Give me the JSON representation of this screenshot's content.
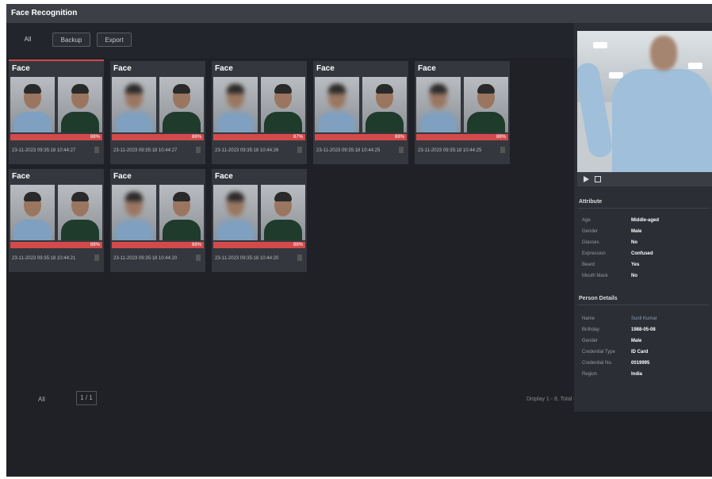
{
  "app": {
    "title": "Face Recognition"
  },
  "toolbar": {
    "all": "All",
    "backup": "Backup",
    "export": "Export"
  },
  "cards": [
    {
      "label": "Face",
      "score": "88%",
      "time": "23-11-2023 09:35:18 10:44:27",
      "selected": true
    },
    {
      "label": "Face",
      "score": "88%",
      "time": "23-11-2023 09:35:18 10:44:27",
      "selected": false
    },
    {
      "label": "Face",
      "score": "87%",
      "time": "23-11-2023 09:35:18 10:44:26",
      "selected": false
    },
    {
      "label": "Face",
      "score": "88%",
      "time": "23-11-2023 09:35:18 10:44:25",
      "selected": false
    },
    {
      "label": "Face",
      "score": "88%",
      "time": "23-11-2023 09:35:18 10:44:25",
      "selected": false
    },
    {
      "label": "Face",
      "score": "88%",
      "time": "23-11-2023 09:35:18 10:44:21",
      "selected": false
    },
    {
      "label": "Face",
      "score": "88%",
      "time": "23-11-2023 09:35:18 10:44:20",
      "selected": false
    },
    {
      "label": "Face",
      "score": "88%",
      "time": "23-11-2023 09:35:18 10:44:20",
      "selected": false
    }
  ],
  "pager": {
    "left": "All",
    "box": "1 / 1",
    "right": "Display 1 - 8, Total 8"
  },
  "attributes": {
    "title": "Attribute",
    "rows": [
      {
        "k": "Age",
        "v": "Middle-aged"
      },
      {
        "k": "Gender",
        "v": "Male"
      },
      {
        "k": "Glasses",
        "v": "No"
      },
      {
        "k": "Expression",
        "v": "Confused"
      },
      {
        "k": "Beard",
        "v": "Yes"
      },
      {
        "k": "Mouth Mask",
        "v": "No"
      }
    ]
  },
  "person": {
    "title": "Person Details",
    "rows": [
      {
        "k": "Name",
        "v": "Sunil Kumar"
      },
      {
        "k": "Birthday",
        "v": "1988-05-08"
      },
      {
        "k": "Gender",
        "v": "Male"
      },
      {
        "k": "Credential Type",
        "v": "ID Card"
      },
      {
        "k": "Credential No.",
        "v": "0019995"
      },
      {
        "k": "Region",
        "v": "India"
      }
    ]
  }
}
